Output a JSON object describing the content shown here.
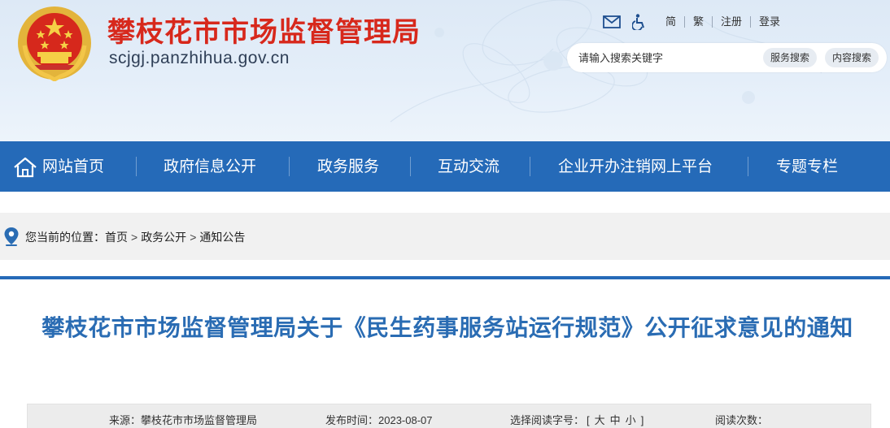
{
  "header": {
    "title": "攀枝花市市场监督管理局",
    "domain": "scjgj.panzhihua.gov.cn",
    "top_links": [
      "简",
      "繁",
      "注册",
      "登录"
    ],
    "search": {
      "placeholder": "请输入搜索关键字",
      "service_button": "服务搜索",
      "content_button": "内容搜索"
    }
  },
  "nav": {
    "items": [
      "网站首页",
      "政府信息公开",
      "政务服务",
      "互动交流",
      "企业开办注销网上平台",
      "专题专栏"
    ]
  },
  "breadcrumb": {
    "label": "您当前的位置：",
    "items": [
      "首页",
      "政务公开",
      "通知公告"
    ],
    "separator": ">"
  },
  "article": {
    "title": "攀枝花市市场监督管理局关于《民生药事服务站运行规范》公开征求意见的通知",
    "source_label": "来源：",
    "source": "攀枝花市市场监督管理局",
    "date_label": "发布时间：",
    "date": "2023-08-07",
    "font_label": "选择阅读字号：",
    "font_open": "[",
    "font_sizes": [
      "大",
      "中",
      "小"
    ],
    "font_close": "]",
    "views_label": "阅读次数："
  },
  "colors": {
    "brand_red": "#d7281c",
    "nav_blue": "#256ab8",
    "title_blue": "#2a6cb3"
  }
}
